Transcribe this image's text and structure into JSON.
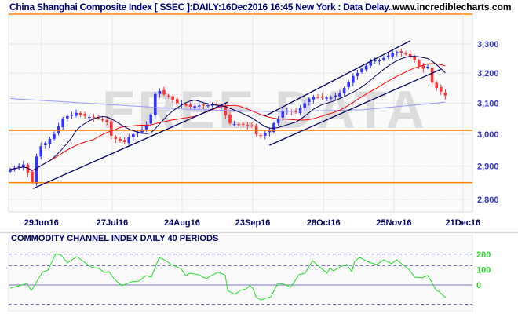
{
  "header": {
    "title": "China Shanghai Composite Index [ SSEC ]:DAILY:16Dec2016 16:45 New York : Data Delay..",
    "site": "www.incrediblecharts.com"
  },
  "watermark": "FREE DATA",
  "colors": {
    "up": "#3333ff",
    "down": "#ff3333",
    "ma_short": "#000066",
    "ma_mid": "#ff0000",
    "ma_long": "#9999ff",
    "support": "#ff8000",
    "trend": "#000066",
    "cci": "#22dd22"
  },
  "chart_data": [
    {
      "type": "candlestick",
      "title": "China Shanghai Composite Index [ SSEC ] Daily",
      "y_ticks": [
        "3,300",
        "3,200",
        "3,100",
        "3,000",
        "2,900",
        "2,800"
      ],
      "y_tick_values": [
        3300,
        3200,
        3100,
        3000,
        2900,
        2800
      ],
      "ylim": [
        2780,
        3350
      ],
      "y_scale": "log",
      "x_ticks": [
        {
          "label": "29Jun16",
          "day": 7.1
        },
        {
          "label": "27Jul16",
          "day": 23.2
        },
        {
          "label": "24Aug16",
          "day": 39.1
        },
        {
          "label": "23Sep16",
          "day": 55.2
        },
        {
          "label": "28Oct16",
          "day": 71.3
        },
        {
          "label": "25Nov16",
          "day": 87.3
        },
        {
          "label": "21Dec16",
          "day": 103.0
        }
      ],
      "close": [
        2890,
        2895,
        2900,
        2905,
        2880,
        2850,
        2930,
        2962,
        2972,
        2985,
        3000,
        3025,
        3050,
        3058,
        3062,
        3068,
        3062,
        3058,
        3055,
        3052,
        3050,
        3045,
        3038,
        2995,
        2985,
        2978,
        2975,
        2990,
        3000,
        3008,
        3015,
        3030,
        3063,
        3130,
        3140,
        3128,
        3122,
        3110,
        3100,
        3098,
        3092,
        3088,
        3090,
        3092,
        3093,
        3093,
        3094,
        3093,
        3090,
        3060,
        3035,
        3032,
        3030,
        3032,
        3028,
        3025,
        3000,
        2995,
        3003,
        3010,
        3035,
        3050,
        3075,
        3075,
        3073,
        3070,
        3085,
        3100,
        3115,
        3120,
        3119,
        3118,
        3118,
        3118,
        3125,
        3132,
        3150,
        3170,
        3190,
        3200,
        3215,
        3225,
        3240,
        3243,
        3245,
        3252,
        3260,
        3268,
        3272,
        3270,
        3265,
        3255,
        3245,
        3225,
        3215,
        3222,
        3168,
        3150,
        3138,
        3125
      ],
      "moving_averages": [
        {
          "name": "MA10",
          "period": 10
        },
        {
          "name": "MA20",
          "period": 20
        },
        {
          "name": "MA100",
          "anchors": [
            [
              0,
              3115
            ],
            [
              40,
              3080
            ],
            [
              60,
              3072
            ],
            [
              80,
              3078
            ],
            [
              99,
              3103
            ]
          ]
        }
      ],
      "support_lines": [
        3012,
        2850
      ],
      "trendlines": [
        {
          "from": [
            5.2,
            2832
          ],
          "to": [
            49.5,
            3103
          ]
        },
        {
          "from": [
            59,
            2965
          ],
          "to": [
            98,
            3213
          ]
        },
        {
          "from": [
            58,
            3058
          ],
          "to": [
            91,
            3311
          ]
        }
      ]
    },
    {
      "type": "line",
      "title": "COMMODITY CHANNEL INDEX DAILY 40 PERIODS",
      "y_ticks": [
        "200",
        "100",
        "0"
      ],
      "y_tick_values": [
        200,
        100,
        0
      ],
      "dashed_levels": [
        200,
        125,
        -125
      ],
      "ylim": [
        -130,
        240
      ],
      "points": [
        [
          0,
          -20
        ],
        [
          2.1,
          -5
        ],
        [
          3.8,
          10
        ],
        [
          4.8,
          -36
        ],
        [
          5.5,
          -5
        ],
        [
          7.3,
          82
        ],
        [
          8.6,
          97
        ],
        [
          10.4,
          204
        ],
        [
          11.6,
          194
        ],
        [
          13,
          143
        ],
        [
          15.2,
          184
        ],
        [
          16.4,
          158
        ],
        [
          18.4,
          117
        ],
        [
          20.2,
          107
        ],
        [
          21.4,
          82
        ],
        [
          22.5,
          87
        ],
        [
          23.6,
          41
        ],
        [
          25.4,
          -5
        ],
        [
          27.5,
          20
        ],
        [
          29.3,
          26
        ],
        [
          30.9,
          61
        ],
        [
          32.1,
          51
        ],
        [
          33.9,
          179
        ],
        [
          35.4,
          158
        ],
        [
          36.6,
          133
        ],
        [
          38.8,
          107
        ],
        [
          40,
          61
        ],
        [
          40.9,
          77
        ],
        [
          42.9,
          66
        ],
        [
          44.6,
          41
        ],
        [
          46.1,
          66
        ],
        [
          47.3,
          82
        ],
        [
          48.9,
          66
        ],
        [
          49.5,
          -36
        ],
        [
          51.1,
          -61
        ],
        [
          52.3,
          -36
        ],
        [
          53.6,
          -26
        ],
        [
          54.5,
          -5
        ],
        [
          55.2,
          -20
        ],
        [
          55.9,
          -77
        ],
        [
          57,
          -97
        ],
        [
          59.3,
          -77
        ],
        [
          60.9,
          10
        ],
        [
          62.3,
          5
        ],
        [
          63.8,
          -15
        ],
        [
          65.7,
          66
        ],
        [
          67.1,
          77
        ],
        [
          68.8,
          158
        ],
        [
          70.4,
          117
        ],
        [
          72.1,
          77
        ],
        [
          72.7,
          107
        ],
        [
          73.6,
          92
        ],
        [
          75,
          117
        ],
        [
          76.6,
          133
        ],
        [
          77.7,
          87
        ],
        [
          78.4,
          153
        ],
        [
          79.5,
          179
        ],
        [
          81.6,
          148
        ],
        [
          83.4,
          133
        ],
        [
          85,
          163
        ],
        [
          86.8,
          138
        ],
        [
          87.9,
          163
        ],
        [
          89.5,
          128
        ],
        [
          90.7,
          102
        ],
        [
          92,
          51
        ],
        [
          93.6,
          46
        ],
        [
          95,
          61
        ],
        [
          97,
          -36
        ],
        [
          97.5,
          -41
        ],
        [
          98.8,
          -77
        ],
        [
          99.1,
          -82
        ]
      ]
    }
  ]
}
